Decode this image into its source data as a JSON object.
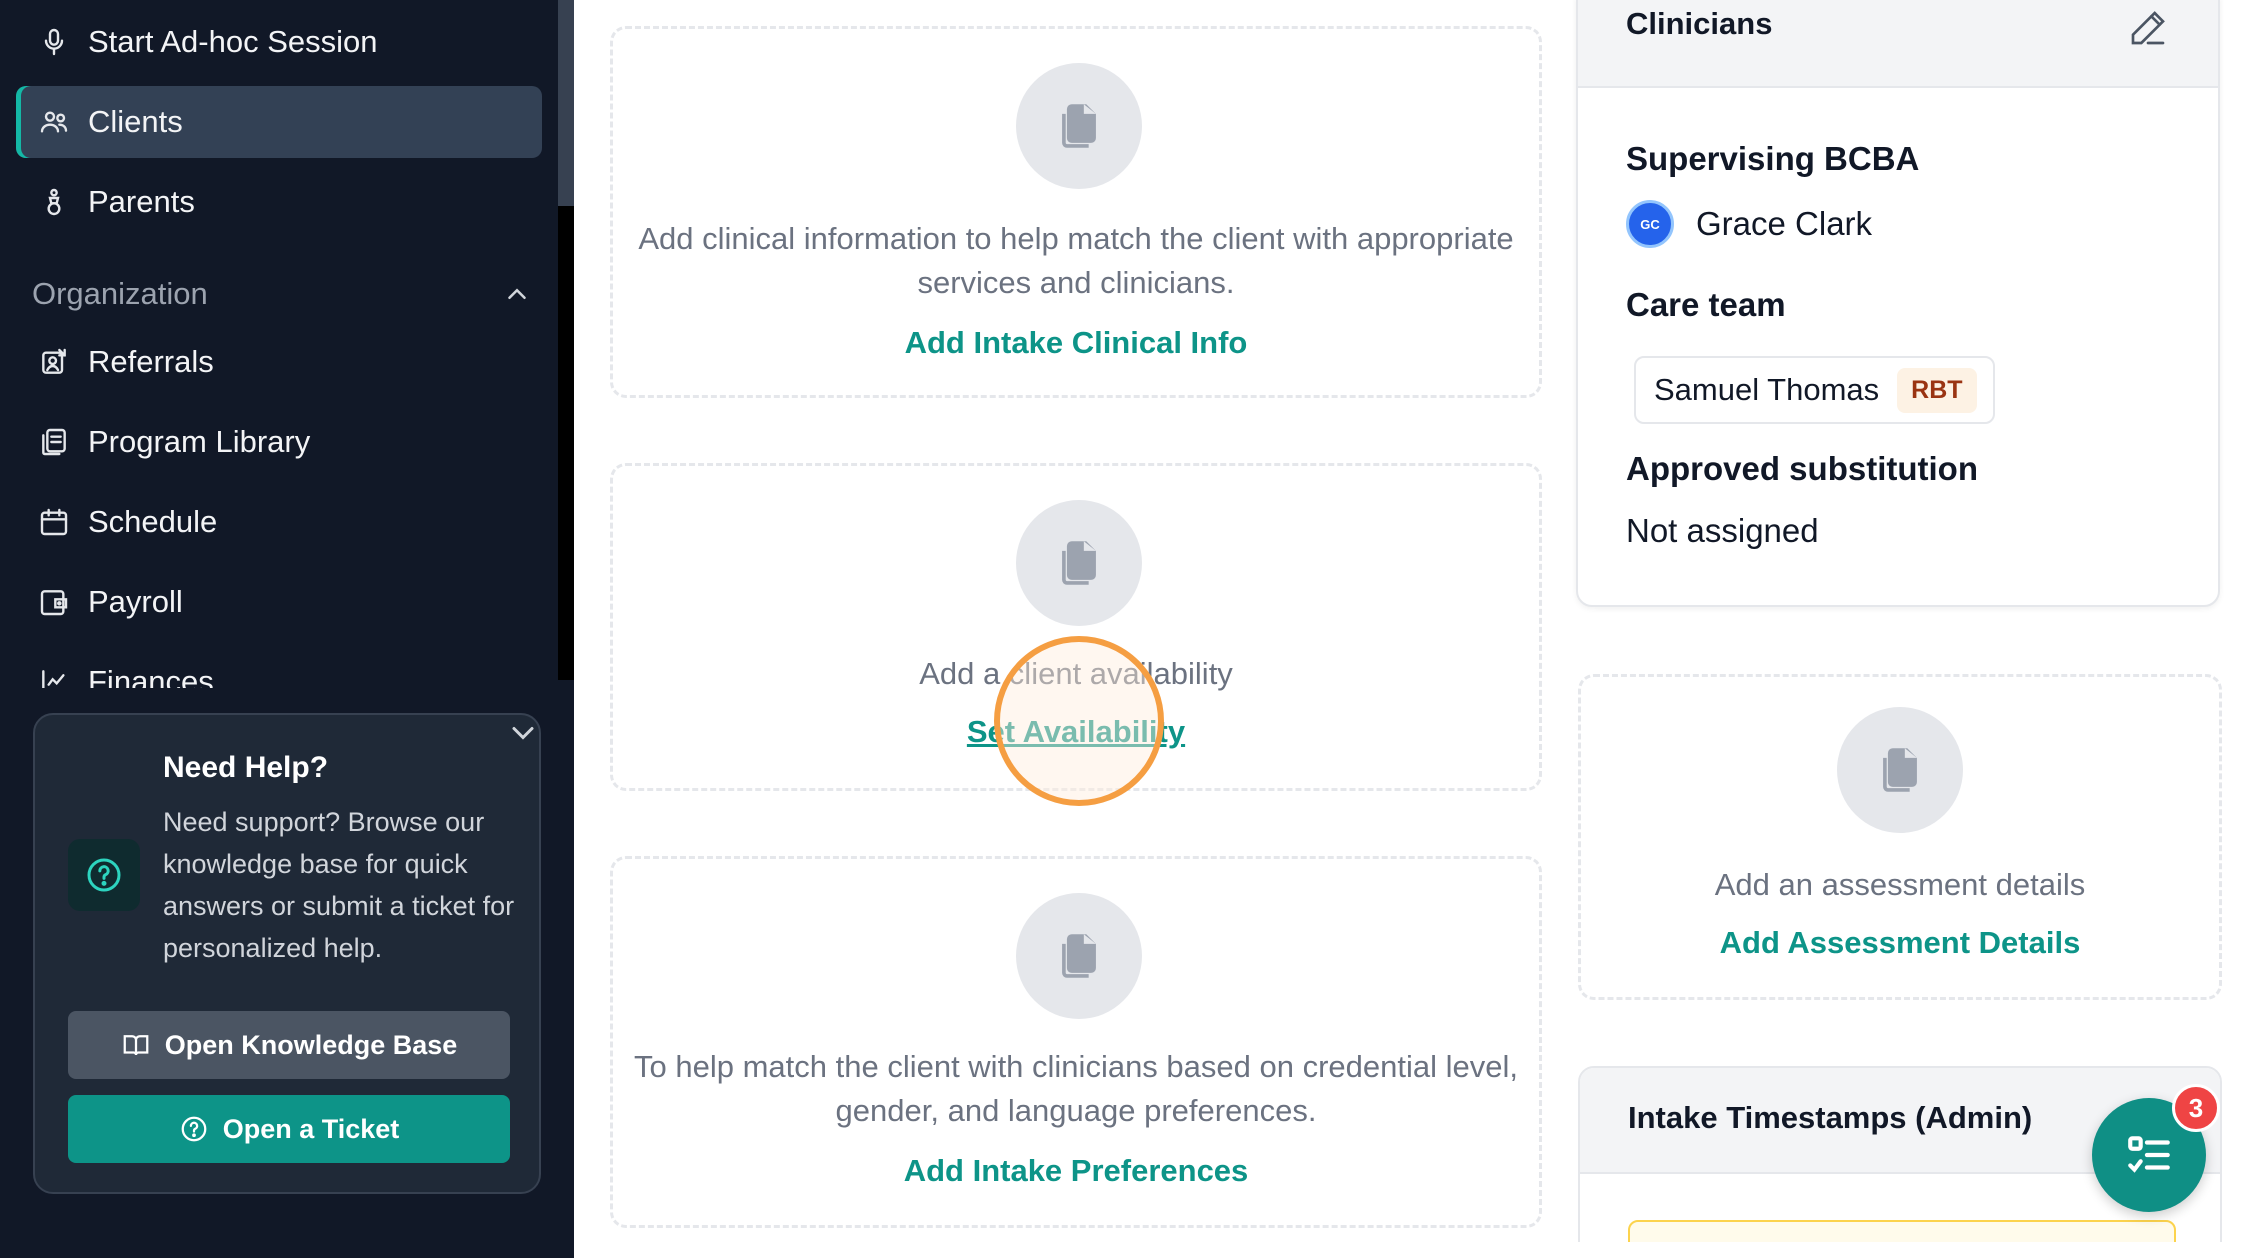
{
  "sidebar": {
    "nav_top": [
      {
        "label": "Start Ad-hoc Session",
        "icon": "microphone-icon"
      },
      {
        "label": "Clients",
        "icon": "users-icon",
        "active": true
      },
      {
        "label": "Parents",
        "icon": "pacifier-icon"
      }
    ],
    "section_title": "Organization",
    "nav_org": [
      {
        "label": "Referrals",
        "icon": "referral-icon"
      },
      {
        "label": "Program Library",
        "icon": "library-icon"
      },
      {
        "label": "Schedule",
        "icon": "calendar-icon"
      },
      {
        "label": "Payroll",
        "icon": "wallet-icon"
      },
      {
        "label": "Finances",
        "icon": "chart-icon"
      }
    ],
    "help": {
      "title": "Need Help?",
      "text": "Need support? Browse our knowledge base for quick answers or submit a ticket for personalized help.",
      "kb_button": "Open Knowledge Base",
      "ticket_button": "Open a Ticket"
    }
  },
  "main": {
    "clinical_info": {
      "description": "Add clinical information to help match the client with appropriate services and clinicians.",
      "action": "Add Intake Clinical Info"
    },
    "availability": {
      "description": "Add a client availability",
      "action": "Set Availability"
    },
    "preferences": {
      "description": "To help match the client with clinicians based on credential level, gender, and language preferences.",
      "action": "Add Intake Preferences"
    }
  },
  "clinicians": {
    "title": "Clinicians",
    "supervising_label": "Supervising BCBA",
    "supervisor": {
      "initials": "GC",
      "name": "Grace Clark"
    },
    "care_team_label": "Care team",
    "care_team": [
      {
        "name": "Samuel Thomas",
        "role": "RBT"
      }
    ],
    "substitution_label": "Approved substitution",
    "substitution_value": "Not assigned"
  },
  "assessment": {
    "description": "Add an assessment details",
    "action": "Add Assessment Details"
  },
  "timestamps": {
    "title": "Intake Timestamps (Admin)"
  },
  "fab": {
    "badge_count": "3"
  },
  "colors": {
    "sidebar_bg": "#111827",
    "accent": "#0d9488",
    "badge": "#ef4444",
    "click_marker": "#f59e42"
  }
}
